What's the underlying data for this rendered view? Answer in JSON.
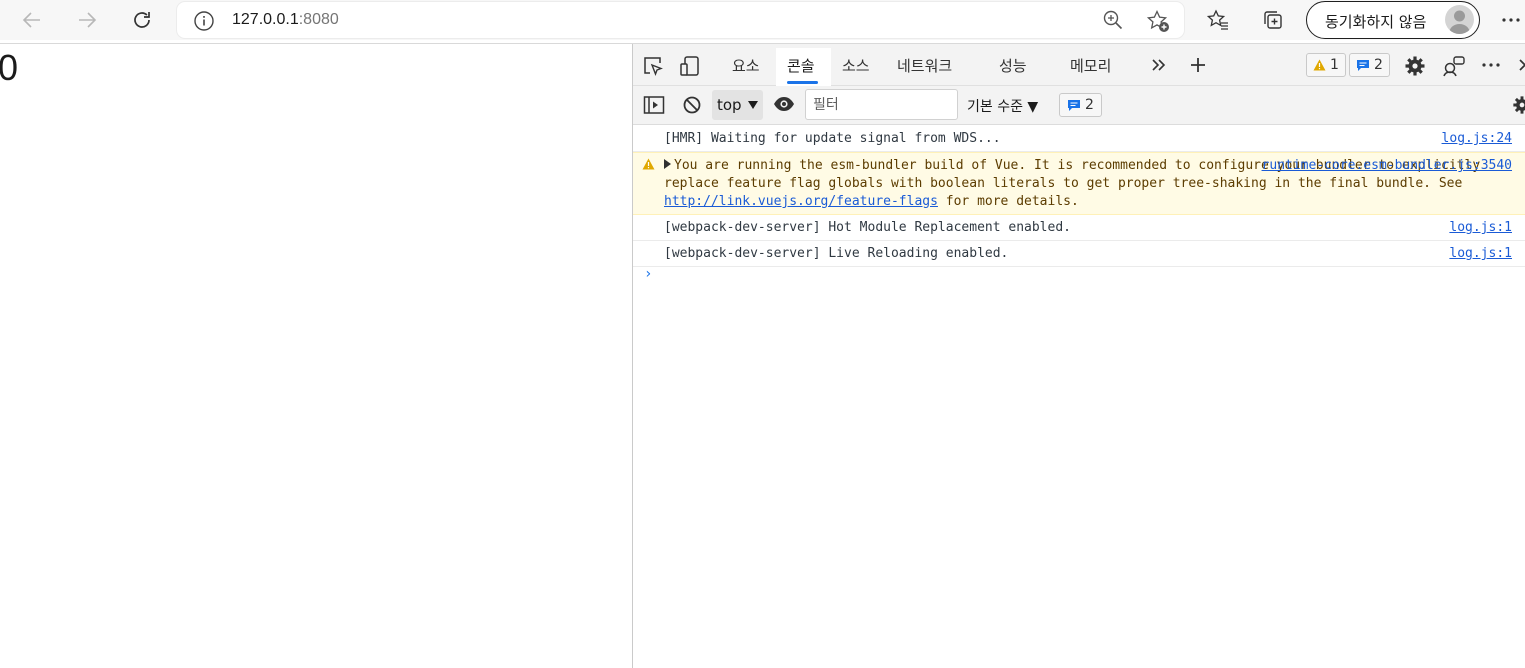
{
  "browser": {
    "url_host": "127.0.0.1",
    "url_port": ":8080",
    "sync_label": "동기화하지 않음"
  },
  "page": {
    "counter": "0"
  },
  "devtools": {
    "tabs": [
      {
        "label": "요소"
      },
      {
        "label": "콘솔"
      },
      {
        "label": "소스"
      },
      {
        "label": "네트워크"
      },
      {
        "label": "성능"
      },
      {
        "label": "메모리"
      }
    ],
    "warnings_count": "1",
    "messages_count": "2",
    "context": "top",
    "filter_placeholder": "필터",
    "levels_label": "기본 수준 ▼",
    "messages_count_bar": "2"
  },
  "console": {
    "rows": [
      {
        "text": "[HMR] Waiting for update signal from WDS...",
        "source": "log.js:24"
      },
      {
        "text_before": "You are running the esm-bundler build of Vue. It is recommended to configure your bundler to explicitly replace feature flag globals with boolean literals to get proper tree-shaking in the final bundle. See ",
        "link": "http://link.vuejs.org/feature-flags",
        "text_after": " for more details.",
        "source": "runtime-core.esm-bundler.js:3540"
      },
      {
        "text": "[webpack-dev-server] Hot Module Replacement enabled.",
        "source": "log.js:1"
      },
      {
        "text": "[webpack-dev-server] Live Reloading enabled.",
        "source": "log.js:1"
      }
    ],
    "prompt": "›"
  },
  "colors": {
    "accent": "#1a73e8",
    "warning_bg": "#fffbe5",
    "warning_icon": "#e0a800",
    "link": "#1a5bd6"
  }
}
